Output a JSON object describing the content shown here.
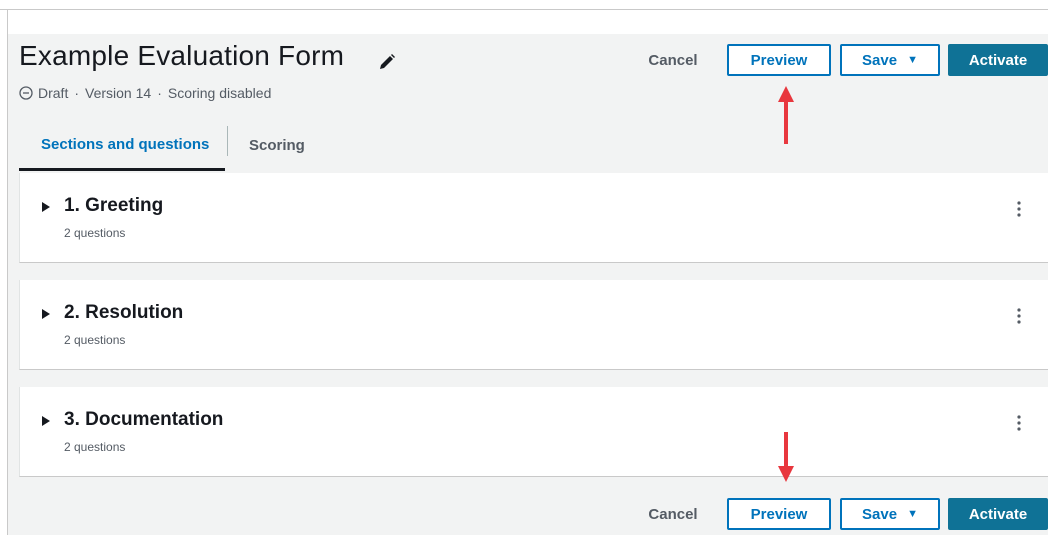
{
  "form": {
    "title": "Example Evaluation Form",
    "status": "Draft",
    "sep1": "·",
    "version": "Version 14",
    "sep2": "·",
    "scoring": "Scoring disabled"
  },
  "header_actions": {
    "cancel": "Cancel",
    "preview": "Preview",
    "save": "Save",
    "activate": "Activate"
  },
  "tabs": [
    {
      "label": "Sections and questions",
      "active": true
    },
    {
      "label": "Scoring",
      "active": false
    }
  ],
  "sections": [
    {
      "title": "1. Greeting",
      "subtitle": "2 questions"
    },
    {
      "title": "2. Resolution",
      "subtitle": "2 questions"
    },
    {
      "title": "3. Documentation",
      "subtitle": "2 questions"
    }
  ],
  "footer_actions": {
    "cancel": "Cancel",
    "preview": "Preview",
    "save": "Save",
    "activate": "Activate"
  },
  "icons": {
    "edit": "pencil-icon",
    "status": "minus-circle-icon",
    "expand": "caret-right-icon",
    "more": "kebab-icon",
    "save_menu": "caret-down-icon",
    "annotation": "red-arrow-icon"
  },
  "colors": {
    "primary": "#0f7296",
    "link_blue": "#0073bb",
    "text": "#16191f",
    "muted": "#545b64",
    "background": "#f2f3f3",
    "annotation_red": "#e8373e"
  }
}
